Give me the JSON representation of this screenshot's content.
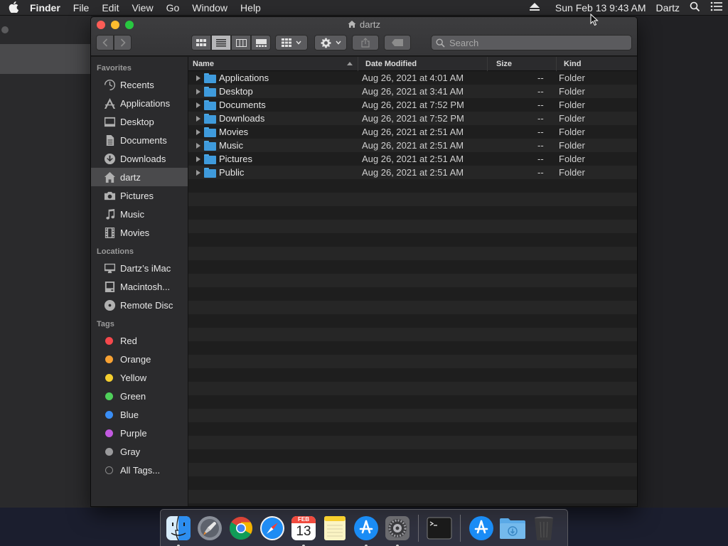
{
  "menubar": {
    "app_name": "Finder",
    "menus": [
      "File",
      "Edit",
      "View",
      "Go",
      "Window",
      "Help"
    ],
    "clock": "Sun Feb 13  9:43 AM",
    "user": "Dartz"
  },
  "window": {
    "title": "dartz",
    "search_placeholder": "Search"
  },
  "sidebar": {
    "favorites_label": "Favorites",
    "favorites": [
      {
        "label": "Recents",
        "icon": "clock-icon"
      },
      {
        "label": "Applications",
        "icon": "applications-icon"
      },
      {
        "label": "Desktop",
        "icon": "desktop-icon"
      },
      {
        "label": "Documents",
        "icon": "document-icon"
      },
      {
        "label": "Downloads",
        "icon": "download-icon"
      },
      {
        "label": "dartz",
        "icon": "home-icon",
        "active": true
      },
      {
        "label": "Pictures",
        "icon": "camera-icon"
      },
      {
        "label": "Music",
        "icon": "music-icon"
      },
      {
        "label": "Movies",
        "icon": "film-icon"
      }
    ],
    "locations_label": "Locations",
    "locations": [
      {
        "label": "Dartz’s iMac",
        "icon": "imac-icon"
      },
      {
        "label": "Macintosh...",
        "icon": "disk-icon"
      },
      {
        "label": "Remote Disc",
        "icon": "disc-icon"
      }
    ],
    "tags_label": "Tags",
    "tags": [
      {
        "label": "Red",
        "color": "#f5484c"
      },
      {
        "label": "Orange",
        "color": "#f8a233"
      },
      {
        "label": "Yellow",
        "color": "#f5cf2f"
      },
      {
        "label": "Green",
        "color": "#4fd05a"
      },
      {
        "label": "Blue",
        "color": "#3a8ef5"
      },
      {
        "label": "Purple",
        "color": "#c25ae0"
      },
      {
        "label": "Gray",
        "color": "#9a9a9c"
      }
    ],
    "all_tags_label": "All Tags..."
  },
  "columns": {
    "name": "Name",
    "date": "Date Modified",
    "size": "Size",
    "kind": "Kind"
  },
  "files": [
    {
      "name": "Applications",
      "date": "Aug 26, 2021 at 4:01 AM",
      "size": "--",
      "kind": "Folder"
    },
    {
      "name": "Desktop",
      "date": "Aug 26, 2021 at 3:41 AM",
      "size": "--",
      "kind": "Folder"
    },
    {
      "name": "Documents",
      "date": "Aug 26, 2021 at 7:52 PM",
      "size": "--",
      "kind": "Folder"
    },
    {
      "name": "Downloads",
      "date": "Aug 26, 2021 at 7:52 PM",
      "size": "--",
      "kind": "Folder"
    },
    {
      "name": "Movies",
      "date": "Aug 26, 2021 at 2:51 AM",
      "size": "--",
      "kind": "Folder"
    },
    {
      "name": "Music",
      "date": "Aug 26, 2021 at 2:51 AM",
      "size": "--",
      "kind": "Folder"
    },
    {
      "name": "Pictures",
      "date": "Aug 26, 2021 at 2:51 AM",
      "size": "--",
      "kind": "Folder"
    },
    {
      "name": "Public",
      "date": "Aug 26, 2021 at 2:51 AM",
      "size": "--",
      "kind": "Folder"
    }
  ],
  "dock": {
    "calendar_month": "FEB",
    "calendar_day": "13",
    "apps": [
      "finder-icon",
      "launchpad-icon",
      "chrome-icon",
      "safari-icon",
      "calendar-icon",
      "notes-icon",
      "app-store-icon",
      "system-preferences-icon",
      "terminal-icon",
      "app-store-icon",
      "downloads-folder-icon",
      "trash-icon"
    ]
  }
}
